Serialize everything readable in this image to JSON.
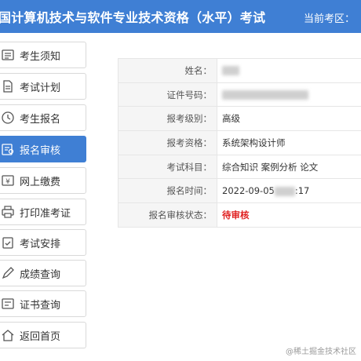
{
  "header": {
    "title": "国计算机技术与软件专业技术资格（水平）考试",
    "right_label": "当前考区："
  },
  "sidebar": {
    "items": [
      {
        "label": "考生须知",
        "icon": "notice-icon"
      },
      {
        "label": "考试计划",
        "icon": "plan-icon"
      },
      {
        "label": "考生报名",
        "icon": "clock-icon"
      },
      {
        "label": "报名审核",
        "icon": "review-icon",
        "active": true
      },
      {
        "label": "网上缴费",
        "icon": "payment-icon"
      },
      {
        "label": "打印准考证",
        "icon": "printer-icon"
      },
      {
        "label": "考试安排",
        "icon": "schedule-icon"
      },
      {
        "label": "成绩查询",
        "icon": "score-icon"
      },
      {
        "label": "证书查询",
        "icon": "certificate-icon"
      },
      {
        "label": "返回首页",
        "icon": "home-icon"
      }
    ]
  },
  "info": {
    "rows": [
      {
        "key": "姓名：",
        "value": ""
      },
      {
        "key": "证件号码：",
        "value": ""
      },
      {
        "key": "报考级别：",
        "value": "高级"
      },
      {
        "key": "报考资格：",
        "value": "系统架构设计师"
      },
      {
        "key": "考试科目：",
        "value": "综合知识 案例分析 论文"
      },
      {
        "key": "报名时间：",
        "value_prefix": "2022-09-05",
        "value_suffix": ":17"
      },
      {
        "key": "报名审核状态：",
        "value": "待审核"
      }
    ]
  },
  "watermark": "@稀土掘金技术社区",
  "colors": {
    "accent": "#3f7fd4",
    "status": "#e02020"
  }
}
